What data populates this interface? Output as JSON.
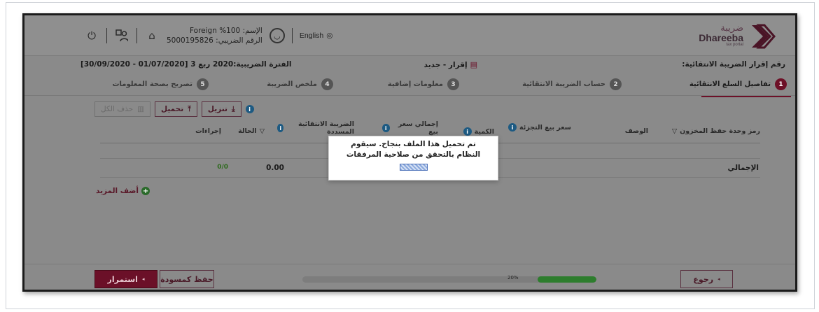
{
  "header": {
    "logo_ar": "ضريبة",
    "logo_en": "Dhareeba",
    "logo_sub": "tax portal",
    "name_label": "الإسم: Foreign %100",
    "tax_number_label": "الرقم الضريبي: 5000195826",
    "language": "English"
  },
  "subbar": {
    "declaration_number": "رقم إقرار الضريبة الانتقائية:",
    "declaration_type": "إقرار - جديد",
    "tax_period": "الفترة الضريبية:2020 ربع 3 [01/07/2020 - 30/09/2020]"
  },
  "steps": [
    {
      "num": "1",
      "label": "تفاصيل السلع الانتقائية",
      "active": true
    },
    {
      "num": "2",
      "label": "حساب الضريبة الانتقائية",
      "active": false
    },
    {
      "num": "3",
      "label": "معلومات إضافية",
      "active": false
    },
    {
      "num": "4",
      "label": "ملخص الضريبة",
      "active": false
    },
    {
      "num": "5",
      "label": "تصريح بصحة المعلومات",
      "active": false
    }
  ],
  "toolbar": {
    "download_label": "تنزيل",
    "upload_label": "تحميل",
    "delete_all_label": "حذف الكل"
  },
  "grid": {
    "columns": {
      "sku": "رمز وحدة حفظ المخزون",
      "description": "الوصف",
      "retail_price": "سعر بيع التجزئة",
      "quantity": "الكمية",
      "total_retail": "إجمالي سعر بيع",
      "excise_paid": "الضريبة الانتقائية المسددة",
      "status": "الحالة",
      "actions": "إجراءات"
    },
    "total_label": "الإجمالي",
    "total_excise": "0.00",
    "total_status": "0/0"
  },
  "add_more_label": "أضف المزيد",
  "footer": {
    "continue_label": "استمرار",
    "save_draft_label": "حفظ كمسودة",
    "progress_text": "20%",
    "back_label": "رجوع"
  },
  "progress": {
    "percent": 20
  },
  "modal": {
    "line1": "تم تحميل هذا الملف بنجاح. سيقوم",
    "line2": "النظام بالتحقق من صلاحية المرفقات"
  },
  "colors": {
    "accent": "#6b1028",
    "progress": "#2d7d2d",
    "info": "#1d5a82"
  }
}
